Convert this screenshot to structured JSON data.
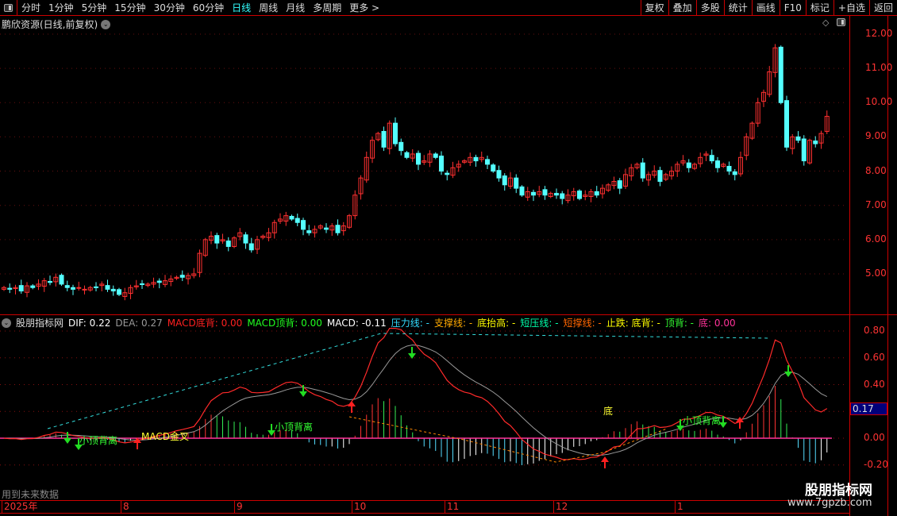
{
  "toolbar": {
    "periods": [
      "分时",
      "1分钟",
      "5分钟",
      "15分钟",
      "30分钟",
      "60分钟",
      "日线",
      "周线",
      "月线",
      "多周期",
      "更多 >"
    ],
    "active": "日线",
    "right_buttons": [
      "复权",
      "叠加",
      "多股",
      "统计",
      "画线",
      "F10",
      "标记",
      "+自选",
      "返回"
    ]
  },
  "title": "鹏欣资源(日线,前复权)",
  "price_axis": [
    "12.00",
    "11.00",
    "10.00",
    "9.00",
    "8.00",
    "7.00",
    "6.00",
    "5.00"
  ],
  "macd_axis": [
    "0.80",
    "0.60",
    "0.40",
    "0.20",
    "0.00",
    "-0.20"
  ],
  "current_value": "0.17",
  "legend": {
    "name": "股朋指标网",
    "items": [
      {
        "label": "DIF: 0.22",
        "color": "#ffffff"
      },
      {
        "label": "DEA: 0.27",
        "color": "#999999"
      },
      {
        "label": "MACD底背: 0.00",
        "color": "#ff2020"
      },
      {
        "label": "MACD顶背: 0.00",
        "color": "#20ff20"
      },
      {
        "label": "MACD: -0.11",
        "color": "#ffffff"
      },
      {
        "label": "压力线: -",
        "color": "#33ddff"
      },
      {
        "label": "支撑线: -",
        "color": "#ffaa00"
      },
      {
        "label": "底抬高: -",
        "color": "#ffff00"
      },
      {
        "label": "短压线: -",
        "color": "#00ffaa"
      },
      {
        "label": "短撑线: -",
        "color": "#ff6600"
      },
      {
        "label": "止跌: 底背: -",
        "color": "#ffff00"
      },
      {
        "label": "顶背: -",
        "color": "#33ff33"
      },
      {
        "label": "底: 0.00",
        "color": "#ff3399"
      }
    ]
  },
  "annotations": {
    "top_div": "小顶背离",
    "golden_cross": "MACD金叉",
    "bottom": "底"
  },
  "footer_note": "用到未来数据",
  "date_axis": [
    "2025年",
    "8",
    "9",
    "10",
    "11",
    "12",
    "1"
  ],
  "watermark": {
    "name": "股朋指标网",
    "url": "www.7gpzb.com"
  },
  "colors": {
    "up": "#ff3030",
    "down": "#54ffff",
    "axis": "#cc0000"
  },
  "chart_data": {
    "type": "candlestick",
    "price_range": [
      4.2,
      12.2
    ],
    "closes": [
      4.6,
      4.55,
      4.6,
      4.5,
      4.65,
      4.6,
      4.7,
      4.8,
      4.75,
      4.9,
      4.7,
      4.6,
      4.55,
      4.6,
      4.55,
      4.6,
      4.6,
      4.7,
      4.55,
      4.5,
      4.4,
      4.45,
      4.6,
      4.65,
      4.7,
      4.7,
      4.75,
      4.75,
      4.8,
      4.85,
      4.9,
      4.9,
      4.95,
      5.0,
      5.6,
      6.0,
      6.1,
      5.9,
      6.0,
      5.8,
      6.05,
      6.2,
      5.9,
      5.7,
      6.0,
      6.1,
      6.2,
      6.5,
      6.6,
      6.7,
      6.6,
      6.5,
      6.3,
      6.2,
      6.3,
      6.4,
      6.3,
      6.4,
      6.2,
      6.4,
      6.7,
      7.3,
      7.8,
      8.4,
      8.9,
      9.1,
      8.7,
      9.4,
      8.8,
      8.6,
      8.4,
      8.5,
      8.2,
      8.3,
      8.5,
      8.4,
      8.0,
      7.9,
      8.1,
      8.2,
      8.3,
      8.4,
      8.3,
      8.4,
      8.2,
      8.0,
      7.8,
      7.6,
      7.8,
      7.5,
      7.3,
      7.4,
      7.3,
      7.4,
      7.3,
      7.35,
      7.3,
      7.2,
      7.3,
      7.4,
      7.2,
      7.3,
      7.4,
      7.3,
      7.5,
      7.6,
      7.7,
      7.5,
      7.9,
      8.1,
      8.2,
      7.8,
      7.9,
      8.0,
      7.7,
      7.9,
      8.0,
      8.2,
      8.3,
      8.1,
      8.2,
      8.4,
      8.5,
      8.3,
      8.1,
      8.2,
      8.0,
      7.9,
      8.4,
      9.0,
      9.4,
      10.0,
      10.3,
      10.9,
      11.6,
      10.0,
      8.7,
      9.0,
      8.9,
      8.3,
      8.9,
      8.8,
      9.1,
      9.6
    ],
    "macd_range": [
      -0.3,
      0.85
    ],
    "indicators": [
      "DIF",
      "DEA",
      "MACD"
    ]
  }
}
